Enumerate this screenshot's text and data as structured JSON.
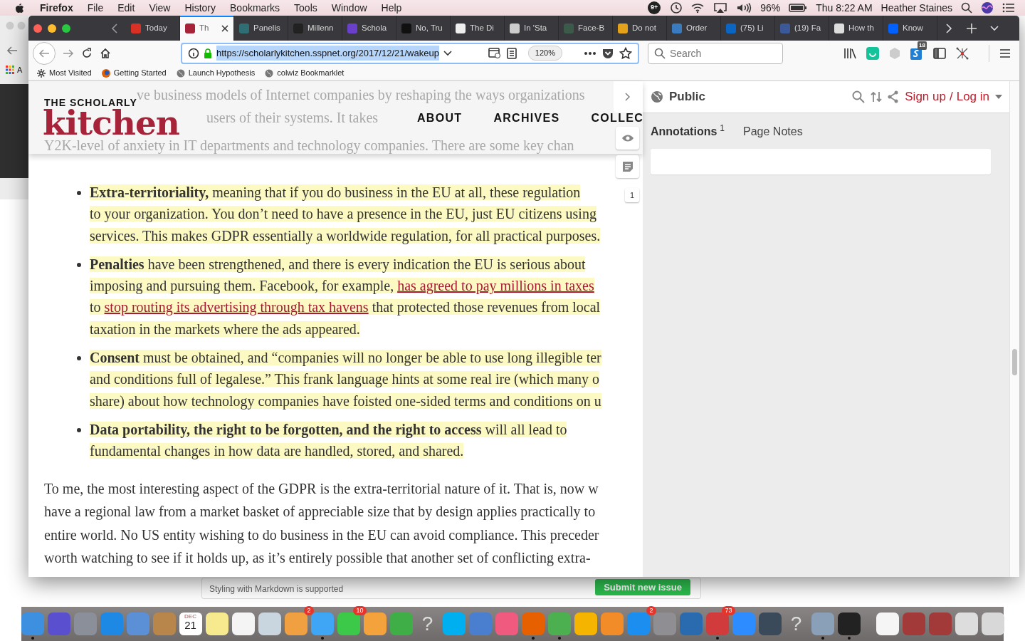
{
  "menubar": {
    "app": "Firefox",
    "menus": [
      "File",
      "Edit",
      "View",
      "History",
      "Bookmarks",
      "Tools",
      "Window",
      "Help"
    ],
    "status": {
      "notification_badge": "9+",
      "battery": "96%",
      "clock": "Thu 8:22 AM",
      "user": "Heather Staines"
    }
  },
  "back_window": {
    "bookmark_fragment": "A"
  },
  "browser": {
    "tabs": [
      {
        "title": "Today",
        "selected": false,
        "color": "#d93025"
      },
      {
        "title": "Th",
        "selected": true,
        "color": "#a6233a"
      },
      {
        "title": "Panelis",
        "selected": false,
        "color": "#2f6f73"
      },
      {
        "title": "Millenn",
        "selected": false,
        "color": "#222222"
      },
      {
        "title": "Schola",
        "selected": false,
        "color": "#6a3fc9"
      },
      {
        "title": "No, Tru",
        "selected": false,
        "color": "#111111"
      },
      {
        "title": "The Di",
        "selected": false,
        "color": "#eeeeee"
      },
      {
        "title": "In 'Sta",
        "selected": false,
        "color": "#cccccc"
      },
      {
        "title": "Face-B",
        "selected": false,
        "color": "#3c5a4a"
      },
      {
        "title": "Do not",
        "selected": false,
        "color": "#e3a21a"
      },
      {
        "title": "Order",
        "selected": false,
        "color": "#3a7bbf"
      },
      {
        "title": "(75) Li",
        "selected": false,
        "color": "#0a66c2"
      },
      {
        "title": "(19) Fa",
        "selected": false,
        "color": "#3b5998"
      },
      {
        "title": "How th",
        "selected": false,
        "color": "#dddddd"
      },
      {
        "title": "Know",
        "selected": false,
        "color": "#0061fe"
      }
    ],
    "url": "https://scholarlykitchen.sspnet.org/2017/12/21/wakeup",
    "zoom": "120%",
    "search_placeholder": "Search",
    "extension_badge": "18",
    "bookmarks": [
      "Most Visited",
      "Getting Started",
      "Launch Hypothesis",
      "colwiz Bookmarklet"
    ]
  },
  "site_header": {
    "kicker": "THE SCHOLARLY",
    "logo": "kitchen",
    "nav": [
      "ABOUT",
      "ARCHIVES",
      "COLLEC"
    ],
    "faded_lines": [
      "ve business models of Internet companies by reshaping the ways organizations",
      "users of their systems. It takes",
      "Y2K-level of anxiety in IT departments and technology companies. There are some key chan"
    ]
  },
  "article": {
    "bullets": [
      {
        "highlighted": true,
        "lines": [
          [
            {
              "kind": "bold",
              "text": "Extra-territoriality,"
            },
            {
              "kind": "plain",
              "text": " meaning that if you do business in the EU at all, these regulation"
            }
          ],
          [
            {
              "kind": "plain",
              "text": "to your organization. You don’t need to have a presence in the EU, just EU citizens using"
            }
          ],
          [
            {
              "kind": "plain",
              "text": "services. This makes GDPR essentially a worldwide regulation, for all practical purposes."
            }
          ]
        ]
      },
      {
        "highlighted": true,
        "lines": [
          [
            {
              "kind": "bold",
              "text": "Penalties"
            },
            {
              "kind": "plain",
              "text": " have been strengthened, and there is every indication the EU is serious about"
            }
          ],
          [
            {
              "kind": "plain",
              "text": "imposing and pursuing them. Facebook, for example, "
            },
            {
              "kind": "link",
              "text": "has agreed to pay millions in taxes"
            }
          ],
          [
            {
              "kind": "plain",
              "text": "to "
            },
            {
              "kind": "link",
              "text": "stop routing its advertising through tax havens"
            },
            {
              "kind": "plain",
              "text": " that protected those revenues from local"
            }
          ],
          [
            {
              "kind": "plain",
              "text": "taxation in the markets where the ads appeared."
            }
          ]
        ]
      },
      {
        "highlighted": true,
        "lines": [
          [
            {
              "kind": "bold",
              "text": "Consent"
            },
            {
              "kind": "plain",
              "text": " must be obtained, and “companies will no longer be able to use long illegible ter"
            }
          ],
          [
            {
              "kind": "plain",
              "text": "and conditions full of legalese.” This frank language hints at some real ire (which many o"
            }
          ],
          [
            {
              "kind": "plain",
              "text": "share) about how technology companies have foisted one-sided terms and conditions on u"
            }
          ]
        ]
      },
      {
        "highlighted": true,
        "lines": [
          [
            {
              "kind": "bold",
              "text": "Data portability, the right to be forgotten, and the right to access"
            },
            {
              "kind": "plain",
              "text": " will all lead to"
            }
          ],
          [
            {
              "kind": "plain",
              "text": "fundamental changes in how data are handled, stored, and shared."
            }
          ]
        ]
      }
    ],
    "paragraph_lines": [
      "To me, the most interesting aspect of the GDPR is the extra-territorial nature of it. That is, now w",
      "have a regional law from a market basket of appreciable size that by design applies practically to",
      "entire world. No US entity wishing to do business in the EU can avoid compliance. This preceder",
      "worth watching to see if it holds up, as it’s entirely possible that another set of conflicting extra-"
    ]
  },
  "annotation_sidebar": {
    "bucket_count": "1",
    "visibility": "Public",
    "sign_up": "Sign up",
    "separator": "/",
    "log_in": "Log in",
    "tabs": [
      {
        "label": "Annotations",
        "count": "1",
        "selected": true
      },
      {
        "label": "Page Notes",
        "selected": false
      }
    ]
  },
  "background_page": {
    "hint": "Styling with Markdown is supported",
    "button": "Submit new issue"
  },
  "dock": {
    "apps": [
      {
        "kind": "tile",
        "color": "#3d8fe0",
        "running": true
      },
      {
        "kind": "tile",
        "color": "#5a4fcf",
        "running": false
      },
      {
        "kind": "tile",
        "color": "#8a8f99",
        "running": false
      },
      {
        "kind": "tile",
        "color": "#1e88e5",
        "running": false
      },
      {
        "kind": "tile",
        "color": "#5b8fd6",
        "running": false
      },
      {
        "kind": "tile",
        "color": "#b8864b",
        "running": false
      },
      {
        "kind": "calendar",
        "month": "DEC",
        "day": "21",
        "running": false
      },
      {
        "kind": "tile",
        "color": "#f7e98e",
        "running": false
      },
      {
        "kind": "tile",
        "color": "#f4f4f4",
        "running": false
      },
      {
        "kind": "tile",
        "color": "#c9d6e0",
        "running": false
      },
      {
        "kind": "tile",
        "color": "#f0a040",
        "badge": "2",
        "running": false
      },
      {
        "kind": "tile",
        "color": "#3ea6f5",
        "running": true
      },
      {
        "kind": "tile",
        "color": "#3cc94a",
        "badge": "10",
        "running": false
      },
      {
        "kind": "tile",
        "color": "#f4a23c",
        "running": false
      },
      {
        "kind": "tile",
        "color": "#3fae47",
        "running": false
      },
      {
        "kind": "glyph",
        "glyph": "?",
        "running": false
      },
      {
        "kind": "tile",
        "color": "#00aff0",
        "running": false
      },
      {
        "kind": "tile",
        "color": "#4a7fd0",
        "running": false
      },
      {
        "kind": "tile",
        "color": "#f05a7e",
        "running": false
      },
      {
        "kind": "tile",
        "color": "#e66000",
        "running": true
      },
      {
        "kind": "tile",
        "color": "#4caf50",
        "running": true
      },
      {
        "kind": "tile",
        "color": "#f5b400",
        "running": false
      },
      {
        "kind": "tile",
        "color": "#f28c28",
        "running": false
      },
      {
        "kind": "tile",
        "color": "#1c8ef0",
        "badge": "2",
        "running": false
      },
      {
        "kind": "tile",
        "color": "#8e8e93",
        "running": false
      },
      {
        "kind": "tile",
        "color": "#2a6bb0",
        "running": false
      },
      {
        "kind": "tile",
        "color": "#d13b3b",
        "badge": "73",
        "running": true
      },
      {
        "kind": "tile",
        "color": "#2d8cff",
        "running": false
      },
      {
        "kind": "tile",
        "color": "#3a4a5a",
        "running": false
      },
      {
        "kind": "glyph",
        "glyph": "?",
        "running": false
      },
      {
        "kind": "tile",
        "color": "#8aa0b8",
        "running": true
      },
      {
        "kind": "tile",
        "color": "#222222",
        "running": true
      },
      {
        "kind": "separator"
      },
      {
        "kind": "tile",
        "color": "#f5f5f5",
        "running": false
      },
      {
        "kind": "tile",
        "color": "#a33a3a",
        "running": false
      },
      {
        "kind": "tile",
        "color": "#a33a3a",
        "running": false
      },
      {
        "kind": "tile",
        "color": "#dddddd",
        "running": false
      },
      {
        "kind": "tile",
        "color": "#d8d8d8",
        "running": false
      }
    ]
  }
}
